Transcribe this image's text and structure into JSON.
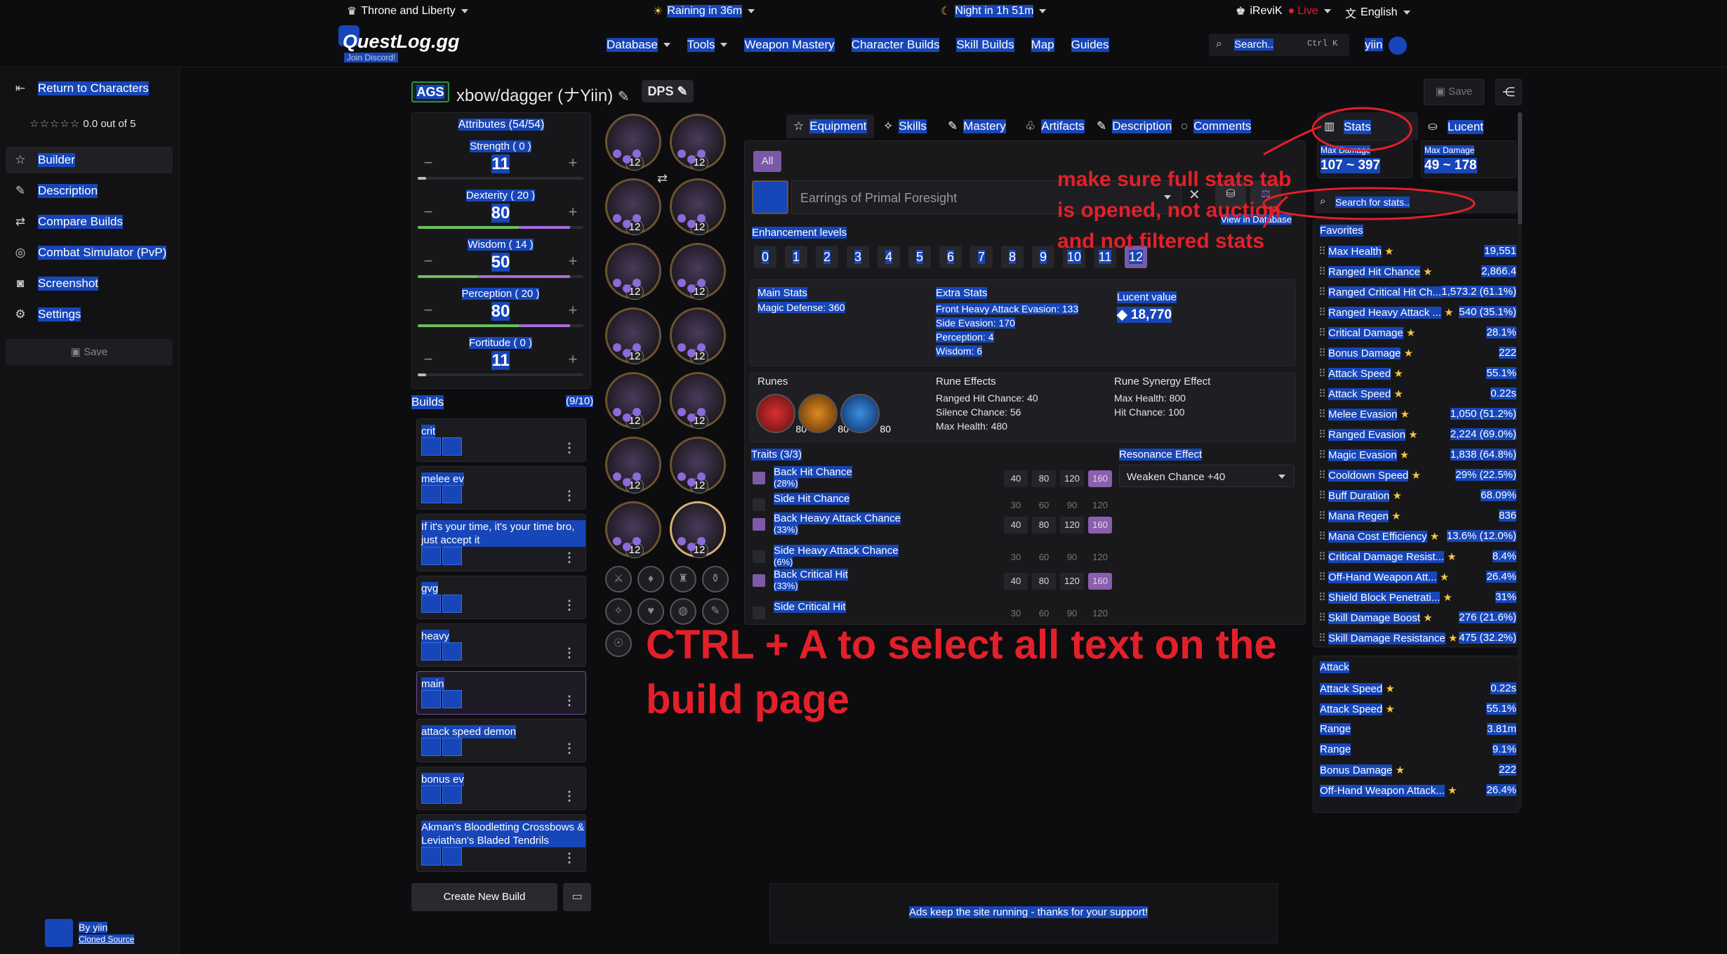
{
  "header": {
    "game_select": "Throne and Liberty",
    "weather": "Raining in 36m",
    "night": "Night in 1h 51m",
    "user_live": "iReviK",
    "live_label": "Live",
    "language": "English",
    "logo": "QuestLog.gg",
    "discord": "Join Discord!",
    "nav": [
      "Database",
      "Tools",
      "Weapon Mastery",
      "Character Builds",
      "Skill Builds",
      "Map",
      "Guides"
    ],
    "search_placeholder": "Search..",
    "search_shortcut": "Ctrl K",
    "username": "yiin"
  },
  "sidebar": {
    "back": "Return to Characters",
    "rating": "0.0 out of 5",
    "items": [
      "Builder",
      "Description",
      "Compare Builds",
      "Combat Simulator (PvP)",
      "Screenshot",
      "Settings"
    ],
    "save": "Save",
    "author": "By yiin",
    "cloned": "Cloned Source"
  },
  "build": {
    "badge": "AGS",
    "name": "xbow/dagger (ナYiin)",
    "role": "DPS",
    "save": "Save"
  },
  "attributes": {
    "title": "Attributes (54/54)",
    "items": [
      {
        "label": "Strength ( 0 )",
        "value": "11",
        "fill": 0.05,
        "color": "#bbbbbb"
      },
      {
        "label": "Dexterity ( 20 )",
        "value": "80",
        "fill": 0.62,
        "color": "#6bbf5a"
      },
      {
        "label": "Wisdom ( 14 )",
        "value": "50",
        "fill": 0.37,
        "color": "#6bbf5a"
      },
      {
        "label": "Perception ( 20 )",
        "value": "80",
        "fill": 0.62,
        "color": "#6bbf5a"
      },
      {
        "label": "Fortitude ( 0 )",
        "value": "11",
        "fill": 0.05,
        "color": "#bbbbbb"
      }
    ]
  },
  "builds": {
    "title": "Builds",
    "count": "(9/10)",
    "items": [
      "crit",
      "melee ev",
      "If it's your time, it's your time bro, just accept it",
      "gvg",
      "heavy",
      "main",
      "attack speed demon",
      "bonus ev",
      "Akman's Bloodletting Crossbows & Leviathan's Bladed Tendrils"
    ],
    "create": "Create New Build"
  },
  "gear_level": "12",
  "tabs": [
    "Equipment",
    "Skills",
    "Mastery",
    "Artifacts",
    "Description",
    "Comments"
  ],
  "equipment": {
    "filter": "All",
    "item_name": "Earrings of Primal Foresight",
    "view_db": "View in Database",
    "enh_title": "Enhancement levels",
    "levels": [
      "0",
      "1",
      "2",
      "3",
      "4",
      "5",
      "6",
      "7",
      "8",
      "9",
      "10",
      "11",
      "12"
    ],
    "main_stats_title": "Main Stats",
    "main_stats": "Magic Defense: 360",
    "extra_title": "Extra Stats",
    "extra": [
      "Front Heavy Attack Evasion: 133",
      "Side Evasion: 170",
      "Perception: 4",
      "Wisdom: 6"
    ],
    "lucent_title": "Lucent value",
    "lucent": "18,770",
    "runes_title": "Runes",
    "rune_level": "80",
    "rune_effects_title": "Rune Effects",
    "rune_effects": [
      "Ranged Hit Chance: 40",
      "Silence Chance: 56",
      "Max Health: 480"
    ],
    "synergy_title": "Rune Synergy Effect",
    "synergy": [
      "Max Health: 800",
      "Hit Chance: 100"
    ],
    "traits_title": "Traits (3/3)",
    "traits": [
      {
        "name": "Back Hit Chance",
        "pct": "(28%)",
        "on": true,
        "vals": [
          "40",
          "80",
          "120",
          "160"
        ]
      },
      {
        "name": "Side Hit Chance",
        "pct": "",
        "on": false,
        "vals": [
          "30",
          "60",
          "90",
          "120"
        ]
      },
      {
        "name": "Back Heavy Attack Chance",
        "pct": "(33%)",
        "on": true,
        "vals": [
          "40",
          "80",
          "120",
          "160"
        ]
      },
      {
        "name": "Side Heavy Attack Chance",
        "pct": "(6%)",
        "on": false,
        "vals": [
          "30",
          "60",
          "90",
          "120"
        ]
      },
      {
        "name": "Back Critical Hit",
        "pct": "(33%)",
        "on": true,
        "vals": [
          "40",
          "80",
          "120",
          "160"
        ]
      },
      {
        "name": "Side Critical Hit",
        "pct": "",
        "on": false,
        "vals": [
          "30",
          "60",
          "90",
          "120"
        ]
      }
    ],
    "resonance_title": "Resonance Effect",
    "resonance": "Weaken Chance +40"
  },
  "stats": {
    "tab_stats": "Stats",
    "tab_lucent": "Lucent",
    "max1_label": "Max Damage",
    "max1": "107 ~ 397",
    "max2_label": "Max Damage",
    "max2": "49 ~ 178",
    "search_placeholder": "Search for stats..",
    "favorites_title": "Favorites",
    "favorites": [
      {
        "n": "Max Health",
        "v": "19,551"
      },
      {
        "n": "Ranged Hit Chance",
        "v": "2,866.4"
      },
      {
        "n": "Ranged Critical Hit Ch...",
        "v": "1,573.2 (61.1%)"
      },
      {
        "n": "Ranged Heavy Attack ...",
        "v": "540 (35.1%)"
      },
      {
        "n": "Critical Damage",
        "v": "28.1%"
      },
      {
        "n": "Bonus Damage",
        "v": "222"
      },
      {
        "n": "Attack Speed",
        "v": "55.1%"
      },
      {
        "n": "Attack Speed",
        "v": "0.22s"
      },
      {
        "n": "Melee Evasion",
        "v": "1,050 (51.2%)"
      },
      {
        "n": "Ranged Evasion",
        "v": "2,224 (69.0%)"
      },
      {
        "n": "Magic Evasion",
        "v": "1,838 (64.8%)"
      },
      {
        "n": "Cooldown Speed",
        "v": "29% (22.5%)"
      },
      {
        "n": "Buff Duration",
        "v": "68.09%"
      },
      {
        "n": "Mana Regen",
        "v": "836"
      },
      {
        "n": "Mana Cost Efficiency",
        "v": "13.6% (12.0%)"
      },
      {
        "n": "Critical Damage Resist...",
        "v": "8.4%"
      },
      {
        "n": "Off-Hand Weapon Att...",
        "v": "26.4%"
      },
      {
        "n": "Shield Block Penetrati...",
        "v": "31%"
      },
      {
        "n": "Skill Damage Boost",
        "v": "276 (21.6%)"
      },
      {
        "n": "Skill Damage Resistance",
        "v": "475 (32.2%)"
      }
    ],
    "attack_title": "Attack",
    "attack": [
      {
        "n": "Attack Speed",
        "v": "0.22s",
        "star": true
      },
      {
        "n": "Attack Speed",
        "v": "55.1%",
        "star": true
      },
      {
        "n": "Range",
        "v": "3.81m",
        "star": false
      },
      {
        "n": "Range",
        "v": "9.1%",
        "star": false
      },
      {
        "n": "Bonus Damage",
        "v": "222",
        "star": true
      },
      {
        "n": "Off-Hand Weapon Attack...",
        "v": "26.4%",
        "star": true
      }
    ]
  },
  "annotations": {
    "note": [
      "make sure full stats tab",
      "is opened, not auction",
      "and not filtered stats"
    ],
    "big": [
      "CTRL + A to select all text on the",
      "build page"
    ]
  },
  "ad": "Ads keep the site running - thanks for your support!"
}
